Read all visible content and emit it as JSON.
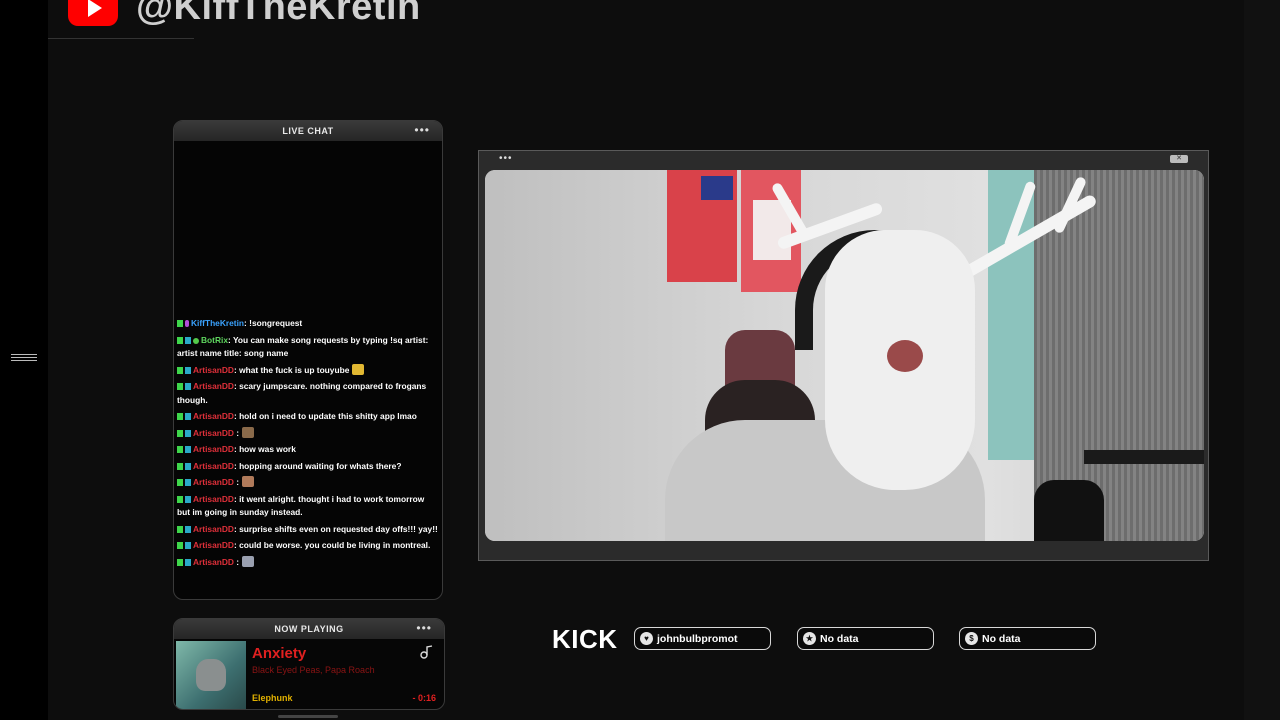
{
  "header": {
    "channel_handle": "@KiffTheKretin"
  },
  "chat": {
    "title": "LIVE CHAT",
    "menu": "•••",
    "messages": [
      {
        "user": "KiffTheKretin",
        "user_color": "#3aa3ff",
        "text": ": !songrequest",
        "badges": [
          "k",
          "p"
        ]
      },
      {
        "user": "BotRix",
        "user_color": "#5fd65f",
        "text": ": You can make song requests by typing !sq artist: artist name title: song name",
        "badges": [
          "k",
          "b",
          "g"
        ]
      },
      {
        "user": "ArtisanDD",
        "user_color": "#e0303a",
        "text": ": what the fuck is up touyube",
        "badges": [
          "k",
          "b"
        ],
        "emote": "#e2b832"
      },
      {
        "user": "ArtisanDD",
        "user_color": "#e0303a",
        "text": ": scary jumpscare. nothing compared to frogans though.",
        "badges": [
          "k",
          "b"
        ]
      },
      {
        "user": "ArtisanDD",
        "user_color": "#e0303a",
        "text": ": hold on i need to update this shitty app lmao",
        "badges": [
          "k",
          "b"
        ]
      },
      {
        "user": "ArtisanDD",
        "user_color": "#e0303a",
        "text": " :",
        "badges": [
          "k",
          "b"
        ],
        "emote": "#8a6a4a"
      },
      {
        "user": "ArtisanDD",
        "user_color": "#e0303a",
        "text": ": how was work",
        "badges": [
          "k",
          "b"
        ]
      },
      {
        "user": "ArtisanDD",
        "user_color": "#e0303a",
        "text": ": hopping around waiting for whats there?",
        "badges": [
          "k",
          "b"
        ]
      },
      {
        "user": "ArtisanDD",
        "user_color": "#e0303a",
        "text": " :",
        "badges": [
          "k",
          "b"
        ],
        "emote": "#b07a5a"
      },
      {
        "user": "ArtisanDD",
        "user_color": "#e0303a",
        "text": ": it went alright. thought i had to work tomorrow but im going in sunday instead.",
        "badges": [
          "k",
          "b"
        ]
      },
      {
        "user": "ArtisanDD",
        "user_color": "#e0303a",
        "text": ": surprise shifts even on requested day offs!!! yay!!",
        "badges": [
          "k",
          "b"
        ]
      },
      {
        "user": "ArtisanDD",
        "user_color": "#e0303a",
        "text": ": could be worse. you could be living in montreal.",
        "badges": [
          "k",
          "b"
        ]
      },
      {
        "user": "ArtisanDD",
        "user_color": "#e0303a",
        "text": " :",
        "badges": [
          "k",
          "b"
        ],
        "emote": "#9aa0b0"
      }
    ]
  },
  "now_playing": {
    "title": "NOW PLAYING",
    "menu": "•••",
    "song": "Anxiety",
    "artists": "Black Eyed Peas, Papa Roach",
    "album": "Elephunk",
    "time": "- 0:16"
  },
  "video": {
    "menu": "•••",
    "close": "✕"
  },
  "stats": {
    "platform": "KICK",
    "items": [
      {
        "icon": "heart-icon",
        "glyph": "♥",
        "label": "johnbulbpromot"
      },
      {
        "icon": "star-icon",
        "glyph": "★",
        "label": "No data"
      },
      {
        "icon": "dollar-icon",
        "glyph": "$",
        "label": "No data"
      }
    ]
  },
  "colors": {
    "youtube_red": "#ff0000",
    "song_red": "#e02020",
    "album_yellow": "#e0b000"
  }
}
